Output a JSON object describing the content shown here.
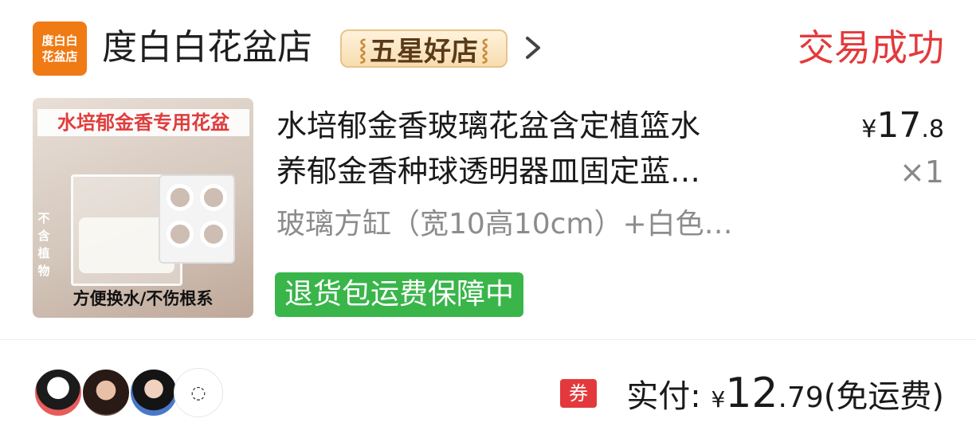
{
  "shop": {
    "logo_line1": "度白白",
    "logo_line2": "花盆店",
    "name": "度白白花盆店",
    "badge": "五星好店",
    "badge_leaf_left": "⸾",
    "badge_leaf_right": "⸾"
  },
  "order": {
    "status": "交易成功",
    "status_color": "#e4393c"
  },
  "product": {
    "thumb_banner": "水培郁金香专用花盆",
    "thumb_side": "不含植物",
    "thumb_bottom": "方便换水/不伤根系",
    "title_line1": "水培郁金香玻璃花盆含定植篮水",
    "title_line2": "养郁金香种球透明器皿固定蓝…",
    "sku": "玻璃方缸（宽10高10cm）+白色…",
    "price_symbol": "¥",
    "price_int": "17",
    "price_dec": ".8",
    "quantity": "×1",
    "tag": "退货包运费保障中",
    "tag_color": "#39b54a"
  },
  "footer": {
    "coupon_label": "券",
    "paid_label": "实付: ",
    "paid_symbol": "¥",
    "paid_int": "12",
    "paid_dec": ".79",
    "paid_note": "(免运费)",
    "more_avatar_icon": "◌"
  }
}
